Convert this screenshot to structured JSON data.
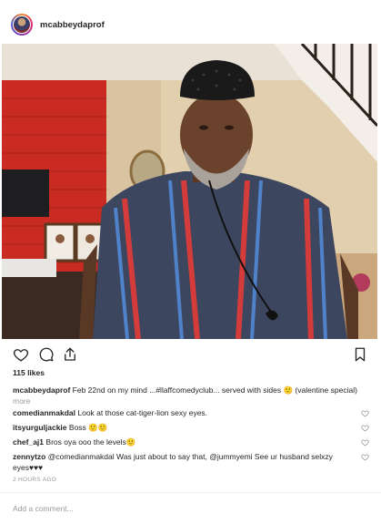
{
  "post": {
    "username": "mcabbeydaprof",
    "likes": "115 likes",
    "caption": {
      "username": "mcabbeydaprof",
      "text": "Feb 22nd on my mind ...#llaffcomedyclub... served with sides 🙂 (valentine special)",
      "more": "more"
    },
    "comments": [
      {
        "username": "comedianmakdal",
        "text": "Look at those cat-tiger-lion sexy eyes."
      },
      {
        "username": "itsyurguljackie",
        "text": "Boss 🙂🙂"
      },
      {
        "username": "chef_aj1",
        "text": "Bros oya ooo the levels🙂"
      },
      {
        "username": "zennytzo",
        "text": "@comedianmakdal Was just about to say that, @jummyemi See ur husband selxzy eyes♥♥♥"
      }
    ],
    "timestamp": "2 HOURS AGO",
    "add_comment_placeholder": "Add a comment..."
  },
  "icons": {
    "like": "heart-icon",
    "comment": "comment-icon",
    "share": "share-icon",
    "save": "bookmark-icon"
  },
  "colors": {
    "text": "#262626",
    "muted": "#999999",
    "border": "#efefef"
  }
}
